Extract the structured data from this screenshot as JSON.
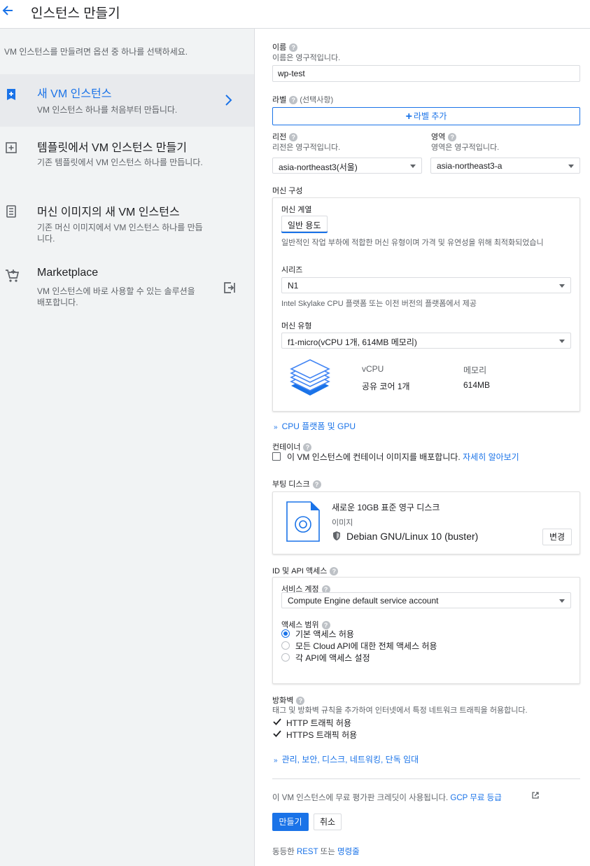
{
  "header": {
    "title": "인스턴스 만들기"
  },
  "sidebar": {
    "intro": "VM 인스턴스를 만들려면 옵션 중 하나를 선택하세요.",
    "items": [
      {
        "title": "새 VM 인스턴스",
        "desc": "VM 인스턴스 하나를 처음부터 만듭니다."
      },
      {
        "title": "템플릿에서 VM 인스턴스 만들기",
        "desc": "기존 템플릿에서 VM 인스턴스 하나를 만듭니다."
      },
      {
        "title": "머신 이미지의 새 VM 인스턴스",
        "desc": "기존 머신 이미지에서 VM 인스턴스 하나를 만듭니다."
      },
      {
        "title": "Marketplace",
        "desc": "VM 인스턴스에 바로 사용할 수 있는 솔루션을 배포합니다."
      }
    ]
  },
  "form": {
    "name": {
      "label": "이름",
      "hint": "이름은 영구적입니다.",
      "value": "wp-test"
    },
    "labels": {
      "label": "라벨",
      "optional": "(선택사항)",
      "add_button": "라벨 추가"
    },
    "region": {
      "label": "리전",
      "hint": "리전은 영구적입니다.",
      "value": "asia-northeast3(서울)"
    },
    "zone": {
      "label": "영역",
      "hint": "영역은 영구적입니다.",
      "value": "asia-northeast3-a"
    },
    "machine_config": {
      "label": "머신 구성",
      "family_label": "머신 계열",
      "family_chip": "일반 용도",
      "family_desc": "일반적인 작업 부하에 적합한 머신 유형이며 가격 및 유연성을 위해 최적화되었습니",
      "series_label": "시리즈",
      "series_value": "N1",
      "series_hint": "Intel Skylake CPU 플랫폼 또는 이전 버전의 플랫폼에서 제공",
      "type_label": "머신 유형",
      "type_value": "f1-micro(vCPU 1개, 614MB 메모리)",
      "vcpu_header": "vCPU",
      "memory_header": "메모리",
      "vcpu_value": "공유 코어 1개",
      "memory_value": "614MB"
    },
    "cpu_platform_link": "CPU 플랫폼 및 GPU",
    "container": {
      "label": "컨테이너",
      "checkbox_label": "이 VM 인스턴스에 컨테이너 이미지를 배포합니다.",
      "learn_more": "자세히 알아보기",
      "checked": false
    },
    "boot_disk": {
      "label": "부팅 디스크",
      "title": "새로운 10GB 표준 영구 디스크",
      "image_label": "이미지",
      "image_value": "Debian GNU/Linux 10 (buster)",
      "change_button": "변경"
    },
    "identity": {
      "label": "ID 및 API 액세스",
      "service_account_label": "서비스 계정",
      "service_account_value": "Compute Engine default service account",
      "access_scope_label": "액세스 범위",
      "options": [
        {
          "label": "기본 액세스 허용",
          "selected": true
        },
        {
          "label": "모든 Cloud API에 대한 전체 액세스 허용",
          "selected": false
        },
        {
          "label": "각 API에 액세스 설정",
          "selected": false
        }
      ]
    },
    "firewall": {
      "label": "방화벽",
      "hint": "태그 및 방화벽 규칙을 추가하여 인터넷에서 특정 네트워크 트래픽을 허용합니다.",
      "http": {
        "label": "HTTP 트래픽 허용",
        "checked": true
      },
      "https": {
        "label": "HTTPS 트래픽 허용",
        "checked": true
      }
    },
    "advanced_link": "관리, 보안, 디스크, 네트워킹, 단독 임대",
    "credit_notice": "이 VM 인스턴스에 무료 평가판 크레딧이 사용됩니다.",
    "credit_link": "GCP 무료 등급",
    "create_button": "만들기",
    "cancel_button": "취소",
    "equivalent_prefix": "동등한",
    "rest_link": "REST",
    "or_text": "또는",
    "cmd_link": "명령줄"
  },
  "colors": {
    "accent": "#1a73e8",
    "sidebar_bg": "#f1f3f4",
    "selected_bg": "#e8eaed"
  }
}
